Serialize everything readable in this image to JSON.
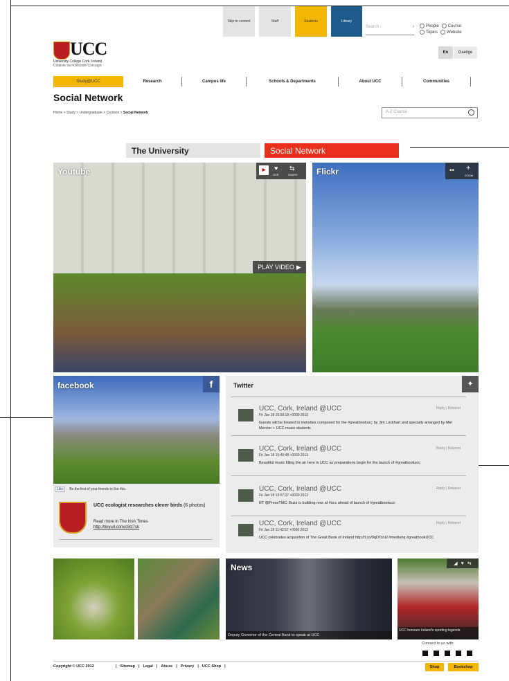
{
  "utility": {
    "skip": "Skip to content",
    "staff": "Staff",
    "students": "Students",
    "library": "Library",
    "search_placeholder": "Search",
    "radios": [
      "People",
      "Course",
      "Topics",
      "Website"
    ]
  },
  "logo": {
    "name": "UCC",
    "sub1": "University College Cork, Ireland",
    "sub2": "Coláiste na hOllscoile Corcaigh"
  },
  "lang": {
    "en": "En",
    "ga": "Gaeilge"
  },
  "nav": [
    "Study@UCC",
    "Research",
    "Campus life",
    "Schools & Departments",
    "About UCC",
    "Communities"
  ],
  "page_title": "Social Network",
  "breadcrumb": {
    "path": "Home > Study > Undergraduate > Courses > ",
    "current": "Social Network"
  },
  "az_placeholder": "A-Z Course",
  "tabs": {
    "university": "The University",
    "social": "Social Network"
  },
  "youtube": {
    "label": "Youtube",
    "like": "LIKE",
    "share": "SHARE",
    "play": "PLAY VIDEO"
  },
  "flickr": {
    "label": "Flickr",
    "zoom": "ZOOM"
  },
  "facebook": {
    "label": "facebook",
    "like": "Like",
    "friends": "Be the first of your friends to like this.",
    "post_title": "UCC ecologist researches clever birds",
    "post_count": "(6 photos)",
    "read_more": "Read more in The Irish Times",
    "link": "http://tinyurl.com/c9ct7sk"
  },
  "twitter": {
    "title": "Twitter",
    "reply": "Reply",
    "retweet": "Retweet",
    "tweets": [
      {
        "name": "UCC, Cork, Ireland @UCC",
        "date": "Fri Jan 18 15:50:18 +0000 2013",
        "text": "Guests will be treated to melodies composed for the #greatbookucc by Jim Lockhart and specially arranged by Mel Mercier + UCC music students"
      },
      {
        "name": "UCC, Cork, Ireland @UCC",
        "date": "Fri Jan 18 15:40:48 +0000 2013",
        "text": "Beautiful music filling the air here in UCC as preparations begin for the launch of #greatbookucc"
      },
      {
        "name": "UCC, Cork, Ireland @UCC",
        "date": "Fri Jan 18 13:57:37 +0000 2013",
        "text": "RT @PressTMC: Buzz is building now at #ucc ahead of launch of #greatbookucc"
      },
      {
        "name": "UCC, Cork, Ireland @UCC",
        "date": "Fri Jan 18 11:42:57 +0000 2013",
        "text": "UCC celebrates acquisition of The Great Book of Ireland http://t.co/9qDTcnIJ #mediahq #greatbookUCC"
      }
    ]
  },
  "news": {
    "label": "News",
    "caption1": "Deputy Governor of the Central Bank to speak at UCC",
    "caption2": "UCC honours Ireland's sporting legends"
  },
  "connect": "Connect to us with:",
  "footer": {
    "copyright": "Copyright © UCC 2012",
    "links": [
      "Sitemap",
      "Legal",
      "Abuse",
      "Privacy",
      "UCC Shop"
    ],
    "shop": "Shop",
    "bookshop": "Bookshop"
  },
  "colors": {
    "yellow": "#f2b705",
    "blue": "#1f5a8c",
    "red": "#e8301c",
    "tab_grey": "#e4e4e4"
  }
}
